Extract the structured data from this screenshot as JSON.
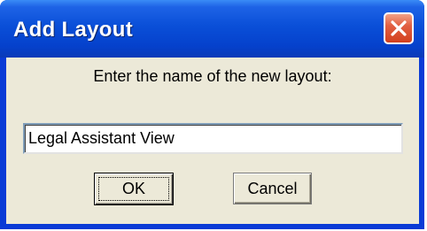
{
  "dialog": {
    "title": "Add Layout",
    "prompt": "Enter the name of the new layout:",
    "name_value": "Legal Assistant View",
    "ok_label": "OK",
    "cancel_label": "Cancel"
  },
  "colors": {
    "titlebar": "#0a4fd8",
    "close_button": "#e26043",
    "dialog_face": "#ece9d8"
  },
  "icons": {
    "close": "close-icon"
  }
}
